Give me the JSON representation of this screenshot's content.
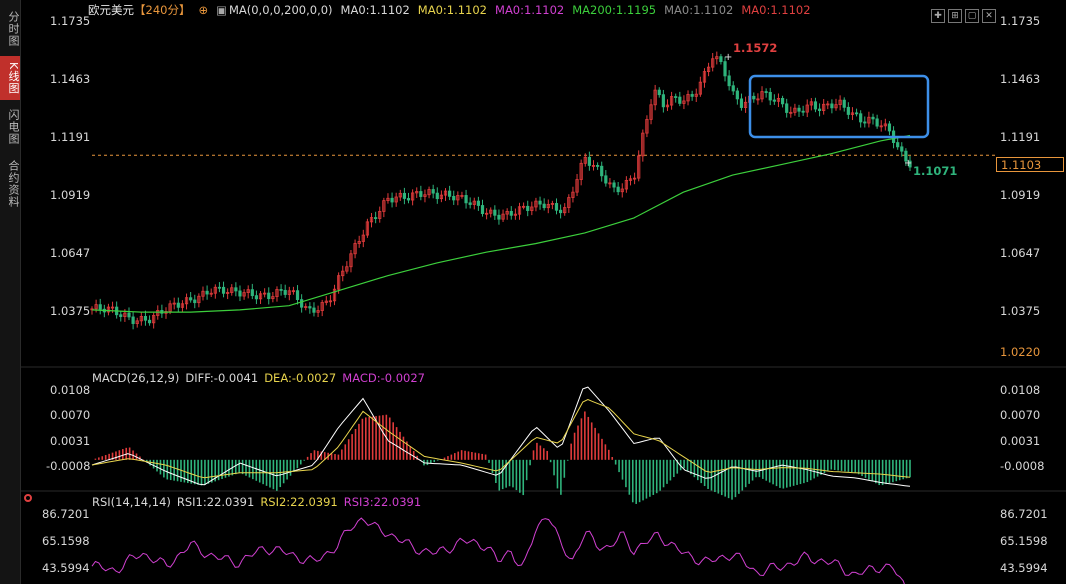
{
  "nav": {
    "items": [
      {
        "label": "分时图"
      },
      {
        "label": "K线图",
        "active": true
      },
      {
        "label": "闪电图"
      },
      {
        "label": "合约资料"
      }
    ]
  },
  "header": {
    "title": "欧元美元",
    "period": "【240分】",
    "ma_params": "MA(0,0,0,200,0,0)",
    "ma_items": [
      {
        "text": "MA0:1.1102",
        "color": "#d8d8d8"
      },
      {
        "text": "MA0:1.1102",
        "color": "#e8d44d"
      },
      {
        "text": "MA0:1.1102",
        "color": "#d040d0"
      },
      {
        "text": "MA200:1.1195",
        "color": "#3ccf3c"
      },
      {
        "text": "MA0:1.1102",
        "color": "#8a8a8a"
      },
      {
        "text": "MA0:1.1102",
        "color": "#e04040"
      }
    ]
  },
  "macd_header": {
    "name": "MACD(26,12,9)",
    "diff": "DIFF:-0.0041",
    "dea": "DEA:-0.0027",
    "macd": "MACD:-0.0027"
  },
  "rsi_header": {
    "name": "RSI(14,14,14)",
    "rsi1": "RSI1:22.0391",
    "rsi2": "RSI2:22.0391",
    "rsi3": "RSI3:22.0391"
  },
  "price_axis": [
    "1.1735",
    "1.1463",
    "1.1191",
    "1.0919",
    "1.0647",
    "1.0375"
  ],
  "current_price_tag": "1.1103",
  "low_price_tag": "1.0220",
  "macd_axis": [
    "0.0108",
    "0.0070",
    "0.0031",
    "-0.0008"
  ],
  "rsi_axis": [
    "86.7201",
    "65.1598",
    "43.5994"
  ],
  "annotations": {
    "high_label": "1.1572",
    "low_label": "1.1071"
  },
  "colors": {
    "up": "#e03b3b",
    "down": "#2fb47c",
    "ma200": "#3ccf3c",
    "diff": "#ffffff",
    "dea": "#e8d44d",
    "rsi": "#d040d0",
    "highlight_box": "#3d8fe8",
    "dashed_line": "#e8963c",
    "period": "#e8963c"
  },
  "chart_data": [
    {
      "type": "candlestick",
      "title": "欧元美元",
      "ylim": [
        1.025,
        1.1735
      ],
      "series": [
        {
          "name": "K",
          "x": [
            0,
            8,
            16,
            24,
            32,
            40,
            48,
            56,
            64,
            72,
            80,
            88,
            96,
            104,
            112,
            120,
            128,
            136,
            144,
            152,
            160,
            168,
            176,
            184,
            192,
            200,
            208,
            212,
            216,
            220,
            224,
            228,
            232,
            236,
            240,
            244,
            248,
            252,
            256,
            260,
            264,
            268,
            272,
            276,
            280,
            284,
            288,
            292,
            296,
            300,
            304,
            308,
            312,
            316,
            320,
            324,
            328,
            332
          ],
          "values": [
            1.0385,
            1.037,
            1.0345,
            1.034,
            1.0385,
            1.0435,
            1.0475,
            1.0455,
            1.0465,
            1.045,
            1.046,
            1.038,
            1.0425,
            1.06,
            1.079,
            1.0905,
            1.0895,
            1.0935,
            1.0925,
            1.088,
            1.084,
            1.083,
            1.0845,
            1.088,
            1.0855,
            1.108,
            1.1,
            1.095,
            1.097,
            1.1,
            1.12,
            1.14,
            1.134,
            1.138,
            1.137,
            1.138,
            1.145,
            1.156,
            1.152,
            1.14,
            1.135,
            1.137,
            1.138,
            1.136,
            1.134,
            1.131,
            1.133,
            1.134,
            1.131,
            1.133,
            1.134,
            1.131,
            1.128,
            1.127,
            1.124,
            1.12,
            1.111,
            1.1071
          ]
        }
      ]
    },
    {
      "type": "line",
      "series": [
        {
          "name": "MA200",
          "x": [
            0,
            20,
            40,
            60,
            80,
            100,
            120,
            140,
            160,
            180,
            200,
            220,
            240,
            260,
            280,
            300,
            310,
            320,
            332
          ],
          "values": [
            1.038,
            1.037,
            1.037,
            1.038,
            1.04,
            1.047,
            1.054,
            1.06,
            1.065,
            1.069,
            1.074,
            1.081,
            1.093,
            1.101,
            1.106,
            1.111,
            1.114,
            1.117,
            1.1195
          ]
        }
      ]
    },
    {
      "type": "bar",
      "title": "MACD(26,12,9)",
      "ylim": [
        -0.0125,
        0.0122
      ],
      "series": [
        {
          "name": "MACD",
          "x": [
            0,
            15,
            30,
            45,
            60,
            75,
            90,
            100,
            110,
            120,
            135,
            150,
            160,
            165,
            170,
            175,
            180,
            185,
            190,
            195,
            200,
            210,
            220,
            230,
            240,
            250,
            260,
            270,
            280,
            290,
            300,
            310,
            320,
            332
          ],
          "values": [
            0.0,
            0.002,
            -0.003,
            -0.004,
            -0.002,
            -0.0048,
            0.0015,
            0.0008,
            0.0065,
            0.007,
            -0.001,
            0.0015,
            0.0008,
            -0.0048,
            -0.004,
            -0.0055,
            0.0028,
            0.0013,
            -0.006,
            0.0035,
            0.0075,
            0.0014,
            -0.007,
            -0.005,
            -0.0012,
            -0.0045,
            -0.0062,
            -0.0025,
            -0.0045,
            -0.0035,
            -0.0015,
            -0.002,
            -0.004,
            -0.0027
          ]
        },
        {
          "name": "DIFF",
          "x": [
            0,
            15,
            30,
            45,
            60,
            75,
            90,
            100,
            110,
            120,
            135,
            150,
            165,
            180,
            190,
            200,
            210,
            220,
            230,
            240,
            250,
            260,
            270,
            280,
            290,
            300,
            310,
            320,
            332
          ],
          "values": [
            -0.0008,
            0.001,
            -0.0018,
            -0.004,
            -0.0005,
            -0.0025,
            -0.0008,
            0.005,
            0.0095,
            0.003,
            -0.0005,
            -0.0008,
            -0.0025,
            0.0052,
            0.0015,
            0.0118,
            0.0075,
            0.0025,
            0.0035,
            -0.0015,
            -0.003,
            -0.001,
            -0.0018,
            -0.0008,
            -0.0015,
            -0.0025,
            -0.0028,
            -0.0035,
            -0.0041
          ]
        },
        {
          "name": "DEA",
          "x": [
            0,
            15,
            30,
            45,
            60,
            75,
            90,
            100,
            110,
            120,
            135,
            150,
            165,
            180,
            190,
            200,
            210,
            220,
            230,
            240,
            250,
            260,
            270,
            280,
            290,
            300,
            310,
            320,
            332
          ],
          "values": [
            -0.0008,
            0.0002,
            -0.0008,
            -0.0028,
            -0.002,
            -0.002,
            -0.0015,
            0.002,
            0.0075,
            0.0045,
            0.0005,
            -0.0005,
            -0.0018,
            0.0035,
            0.0025,
            0.0095,
            0.008,
            0.004,
            0.003,
            0.0005,
            -0.002,
            -0.0012,
            -0.0015,
            -0.0012,
            -0.0013,
            -0.0018,
            -0.002,
            -0.0022,
            -0.0027
          ]
        }
      ]
    },
    {
      "type": "line",
      "title": "RSI(14,14,14)",
      "ylim": [
        35,
        90
      ],
      "series": [
        {
          "name": "RSI",
          "x": [
            0,
            10,
            20,
            30,
            40,
            50,
            60,
            70,
            80,
            90,
            100,
            105,
            110,
            115,
            120,
            130,
            140,
            150,
            160,
            165,
            170,
            175,
            180,
            185,
            190,
            195,
            200,
            205,
            210,
            215,
            220,
            225,
            230,
            240,
            250,
            260,
            270,
            280,
            290,
            300,
            310,
            320,
            325,
            332
          ],
          "values": [
            45,
            42,
            56,
            45,
            62,
            52,
            48,
            60,
            55,
            48,
            62,
            76,
            84,
            75,
            72,
            60,
            55,
            65,
            62,
            48,
            58,
            42,
            74,
            88,
            62,
            50,
            72,
            62,
            60,
            70,
            58,
            64,
            70,
            55,
            48,
            55,
            40,
            45,
            52,
            48,
            38,
            45,
            43.6,
            22.04
          ]
        }
      ]
    }
  ]
}
